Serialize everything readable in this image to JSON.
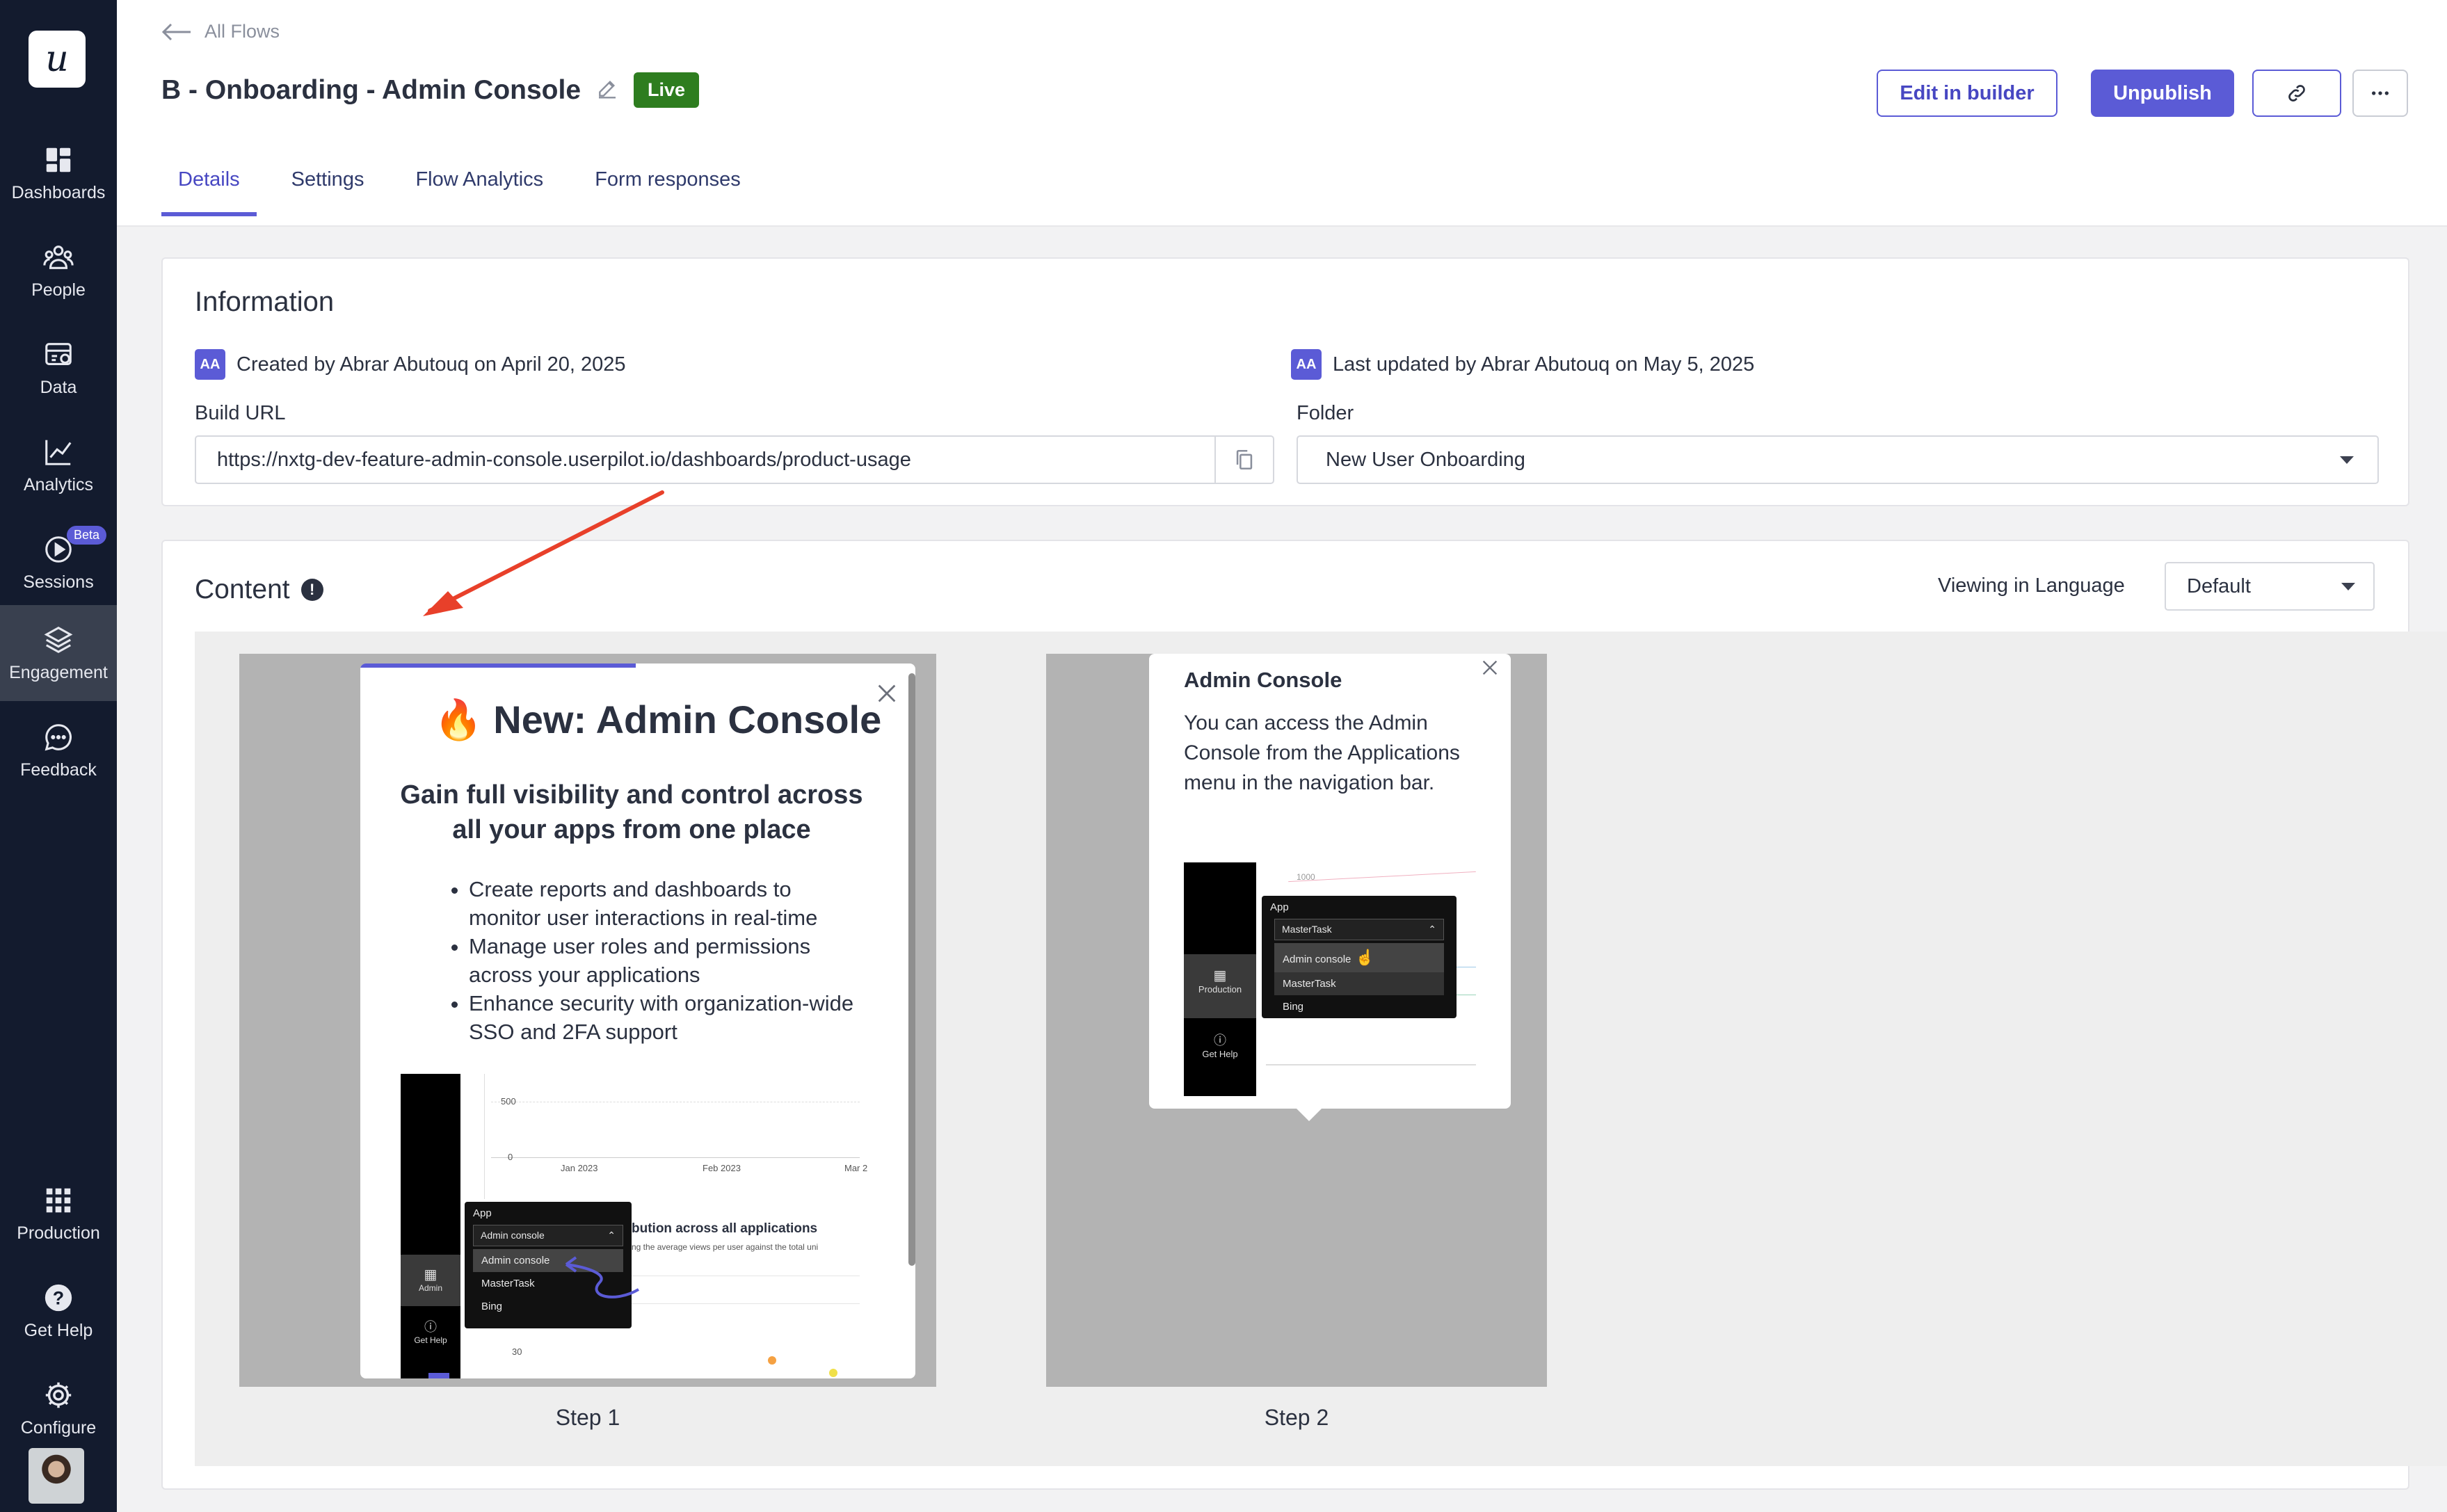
{
  "sidebar": {
    "logo": "u",
    "items": [
      {
        "label": "Dashboards",
        "icon": "dashboard-icon"
      },
      {
        "label": "People",
        "icon": "people-icon"
      },
      {
        "label": "Data",
        "icon": "data-icon"
      },
      {
        "label": "Analytics",
        "icon": "analytics-icon"
      },
      {
        "label": "Sessions",
        "icon": "play-icon",
        "badge": "Beta"
      },
      {
        "label": "Engagement",
        "icon": "layers-icon",
        "active": true
      },
      {
        "label": "Feedback",
        "icon": "chat-icon"
      }
    ],
    "bottom_items": [
      {
        "label": "Production",
        "icon": "grid-icon"
      },
      {
        "label": "Get Help",
        "icon": "help-icon"
      },
      {
        "label": "Configure",
        "icon": "gear-icon"
      }
    ]
  },
  "header": {
    "back_label": "All Flows",
    "title": "B - Onboarding - Admin Console",
    "status": "Live",
    "edit_label": "Edit in builder",
    "unpublish_label": "Unpublish",
    "tabs": [
      "Details",
      "Settings",
      "Flow Analytics",
      "Form responses"
    ],
    "active_tab": "Details",
    "accent": "#5b5bd6"
  },
  "information": {
    "title": "Information",
    "created_initials": "AA",
    "created_text": "Created by Abrar Abutouq on April 20, 2025",
    "updated_initials": "AA",
    "updated_text": "Last updated by Abrar Abutouq on May 5, 2025",
    "build_url_label": "Build URL",
    "build_url": "https://nxtg-dev-feature-admin-console.userpilot.io/dashboards/product-usage",
    "folder_label": "Folder",
    "folder_value": "New User Onboarding"
  },
  "content": {
    "title": "Content",
    "language_label": "Viewing in Language",
    "language_value": "Default",
    "steps": [
      {
        "label": "Step 1",
        "emoji": "🔥",
        "title": "New: Admin Console",
        "subtitle": "Gain full visibility and control across all your apps from one place",
        "bullets": [
          "Create reports and dashboards to monitor user interactions in real-time",
          "Manage user roles and permissions across your applications",
          "Enhance security with organization-wide SSO and 2FA support"
        ],
        "preview": {
          "axis_500": "500",
          "axis_0": "0",
          "axis_30": "30",
          "dates": [
            "Jan 2023",
            "Feb 2023",
            "Mar 2"
          ],
          "heading": "bution across all applications",
          "subheading": "ng the average views per user against the total uni",
          "menu_title": "App",
          "selected": "Admin console",
          "options": [
            "Admin console",
            "MasterTask",
            "Bing"
          ],
          "nav_admin": "Admin",
          "nav_help": "Get Help"
        }
      },
      {
        "label": "Step 2",
        "title": "Admin Console",
        "body": "You can access the Admin Console from the Applications menu in the navigation bar.",
        "preview": {
          "axis_1000": "1000",
          "menu_title": "App",
          "selected": "MasterTask",
          "options": [
            "Admin console",
            "MasterTask",
            "Bing"
          ],
          "nav_production": "Production",
          "nav_help": "Get Help"
        }
      }
    ]
  }
}
